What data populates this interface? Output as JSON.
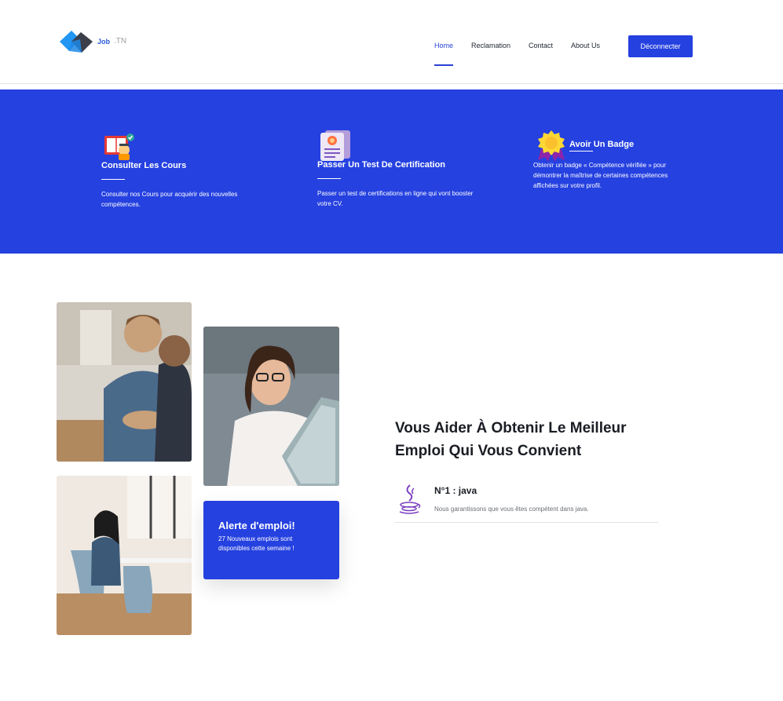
{
  "brand": {
    "name": "Job",
    "suffix": ".TN"
  },
  "nav": {
    "items": [
      {
        "label": "Home",
        "active": true
      },
      {
        "label": "Reclamation",
        "active": false
      },
      {
        "label": "Contact",
        "active": false
      },
      {
        "label": "About Us",
        "active": false
      }
    ],
    "logout_label": "Déconnecter"
  },
  "features": [
    {
      "icon": "courses-icon",
      "title": "Consulter Les Cours",
      "description": "Consulter nos Cours pour acquérir des nouvelles compétences."
    },
    {
      "icon": "certificate-icon",
      "title": "Passer Un Test De Certification",
      "description": "Passer un test de certifications en ligne qui vont booster votre CV."
    },
    {
      "icon": "badge-icon",
      "title": "Avoir Un Badge",
      "description": "Obtenir un badge « Compétence vérifiée » pour démontrer la maîtrise de certaines compétences affichées sur votre profil."
    }
  ],
  "alert": {
    "title": "Alerte d'emploi!",
    "text": "27 Nouveaux emplois sont disponibles cette semaine !"
  },
  "about": {
    "headline": "Vous Aider À Obtenir Le Meilleur Emploi Qui Vous Convient",
    "item": {
      "icon": "java-icon",
      "title": "N°1 : java",
      "description": "Nous garantissons que vous êtes compétent dans java."
    }
  },
  "colors": {
    "primary": "#2541e0",
    "nav_active": "#2a43d4",
    "text_dark": "#1a1d24"
  }
}
